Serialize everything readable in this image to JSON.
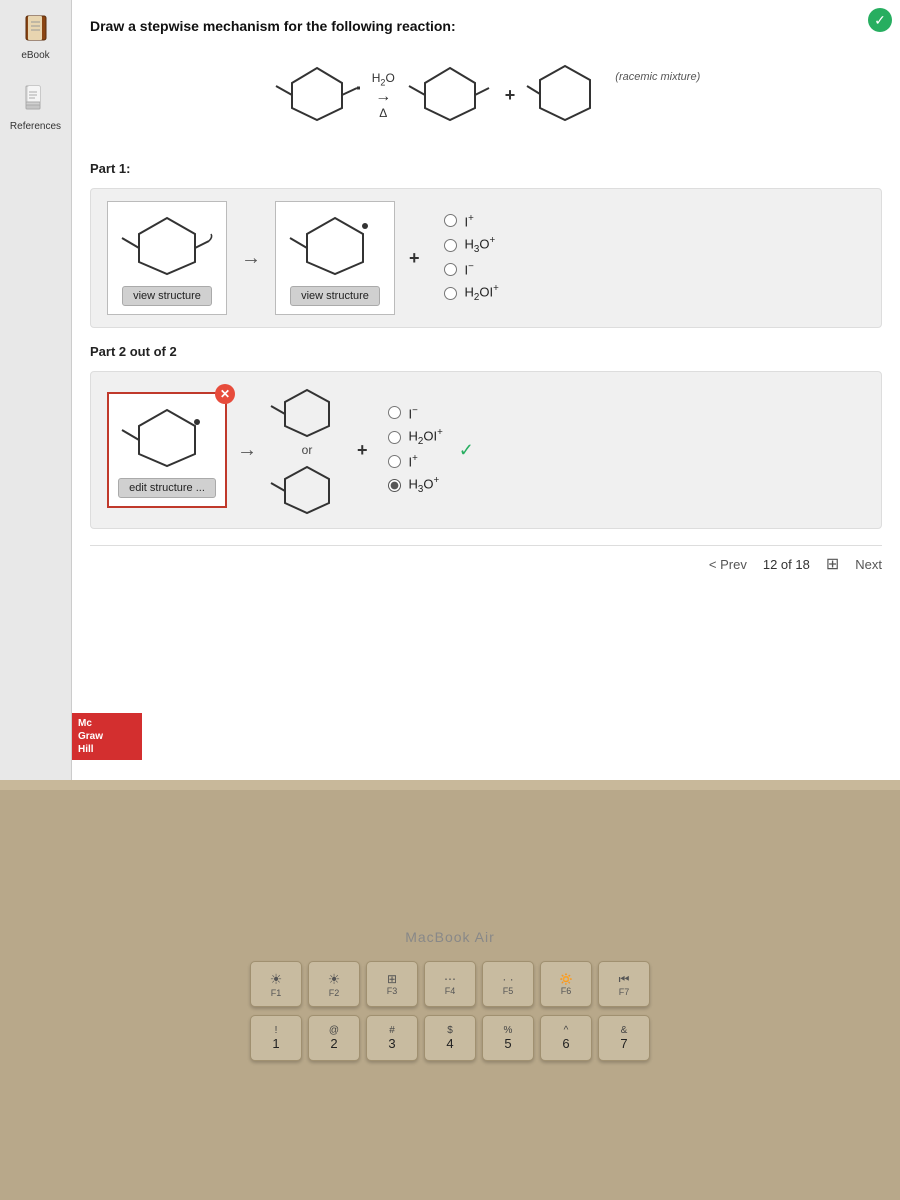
{
  "page": {
    "number": "12",
    "question": "Draw a stepwise mechanism for the following reaction:"
  },
  "sidebar": {
    "items": [
      {
        "id": "ebook",
        "label": "eBook",
        "icon": "book"
      },
      {
        "id": "references",
        "label": "References",
        "icon": "document"
      }
    ]
  },
  "reaction": {
    "reagent": "H₂O",
    "condition": "Δ",
    "racemic_label": "(racemic mixture)"
  },
  "part1": {
    "label": "Part 1:",
    "view_btn1": "view structure",
    "view_btn2": "view structure",
    "options": [
      {
        "id": "opt1",
        "label": "I⁺",
        "checked": false
      },
      {
        "id": "opt2",
        "label": "H₃O⁺",
        "checked": false
      },
      {
        "id": "opt3",
        "label": "I⁻",
        "checked": false
      },
      {
        "id": "opt4",
        "label": "H₂OI⁺",
        "checked": false
      }
    ]
  },
  "part2": {
    "label": "Part 2 out of 2",
    "edit_btn": "edit structure ...",
    "or_text": "or",
    "options": [
      {
        "id": "p2opt1",
        "label": "I⁻",
        "checked": false
      },
      {
        "id": "p2opt2",
        "label": "H₂OI⁺",
        "checked": false
      },
      {
        "id": "p2opt3",
        "label": "I⁺",
        "checked": false
      },
      {
        "id": "p2opt4",
        "label": "H₃O⁺",
        "checked": true
      }
    ]
  },
  "navigation": {
    "prev_label": "< Prev",
    "page_info": "12 of 18",
    "next_label": "Next"
  },
  "brand": {
    "line1": "Mc",
    "line2": "Graw",
    "line3": "Hill"
  },
  "keyboard": {
    "macbook_label": "MacBook Air",
    "fn_row": [
      "F1",
      "F2",
      "F3",
      "F4",
      "F5",
      "F6",
      "F7"
    ],
    "number_row_top": [
      "!",
      "@",
      "#",
      "$",
      "%",
      "^",
      "&"
    ],
    "number_row_bottom": [
      "1",
      "2",
      "3",
      "4",
      "5",
      "6",
      "7"
    ]
  }
}
